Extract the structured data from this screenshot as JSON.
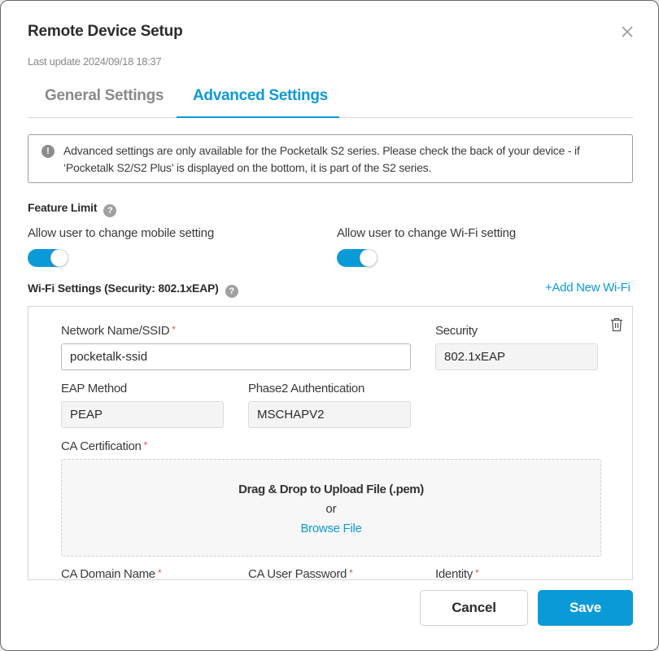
{
  "dialog": {
    "title": "Remote Device Setup",
    "last_update": "Last update 2024/09/18 18:37",
    "close_icon": "close-icon"
  },
  "tabs": [
    {
      "label": "General Settings",
      "active": false
    },
    {
      "label": "Advanced Settings",
      "active": true
    }
  ],
  "notice": {
    "icon": "exclamation-circle-icon",
    "text": "Advanced settings are only available for the Pocketalk S2 series. Please check the back of your device - if ‘Pocketalk S2/S2 Plus’ is displayed on the bottom, it is part of the S2 series."
  },
  "feature_limit": {
    "label": "Feature Limit",
    "help_icon": "question-circle-icon",
    "toggles": [
      {
        "label": "Allow user to change mobile setting",
        "on": true
      },
      {
        "label": "Allow user to change Wi-Fi setting",
        "on": true
      }
    ]
  },
  "wifi_settings": {
    "label": "Wi-Fi Settings (Security: 802.1xEAP)",
    "help_icon": "question-circle-icon",
    "add_button": "Add New Wi-Fi",
    "add_icon": "+",
    "entry": {
      "ssid_label": "Network Name/SSID",
      "ssid_value": "pocketalk-ssid",
      "security_label": "Security",
      "security_value": "802.1xEAP",
      "eap_label": "EAP Method",
      "eap_value": "PEAP",
      "phase2_label": "Phase2 Authentication",
      "phase2_value": "MSCHAPV2",
      "ca_cert_label": "CA Certification",
      "dropzone_title": "Drag & Drop to Upload File (.pem)",
      "dropzone_or": "or",
      "dropzone_browse": "Browse File",
      "ca_domain_label": "CA Domain Name",
      "ca_password_label": "CA User Password",
      "identity_label": "Identity",
      "required_mark": "*"
    }
  },
  "footer": {
    "cancel": "Cancel",
    "save": "Save"
  },
  "colors": {
    "accent": "#0b9ad8",
    "required": "#e8553e",
    "muted": "#888888"
  }
}
